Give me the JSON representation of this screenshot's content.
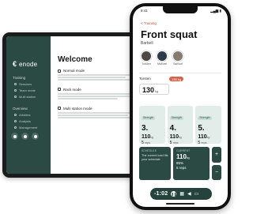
{
  "tablet": {
    "app": {
      "logo_mark": "€",
      "logo_text": "enode"
    },
    "sidebar": {
      "sections": [
        {
          "label": "Training",
          "items": [
            "Sessions",
            "Team mode",
            "Multi station"
          ]
        },
        {
          "label": "Overview",
          "items": [
            "Athletes",
            "Analysis",
            "Management"
          ]
        }
      ]
    },
    "main": {
      "title": "Welcome",
      "modes": [
        {
          "label": "Normal mode",
          "icon": "user-icon"
        },
        {
          "label": "Rack mode",
          "icon": "rack-icon"
        },
        {
          "label": "Multi station mode",
          "icon": "station-icon"
        }
      ]
    }
  },
  "phone": {
    "status": {
      "time": "9:41",
      "icons": "▂▄▆ ▮"
    },
    "back_label": "< Training",
    "exercise": {
      "title": "Front squat",
      "subtitle": "Barbell"
    },
    "athletes": [
      {
        "name": "Torsten"
      },
      {
        "name": "Michael"
      },
      {
        "name": "Samuel"
      }
    ],
    "current": {
      "name": "Torsten",
      "badge": "135 kg",
      "weight": "130",
      "unit": "kg"
    },
    "sets": [
      {
        "label": "Strength",
        "num": "3.",
        "kg": "110",
        "kg_unit": "kg",
        "reps": "5",
        "reps_unit": "reps"
      },
      {
        "label": "Strength",
        "num": "4.",
        "kg": "110",
        "kg_unit": "kg",
        "reps": "5",
        "reps_unit": "reps"
      },
      {
        "label": "Strength",
        "num": "5.",
        "kg": "110",
        "kg_unit": "kg",
        "reps": "5",
        "reps_unit": "reps"
      }
    ],
    "schedule": {
      "label": "SCHEDULE",
      "text": "The current load fits your schedule"
    },
    "current_set": {
      "label": "CURRENT",
      "kg": "110",
      "kg_unit": "kg",
      "reps": "5",
      "reps_unit": "reps",
      "pct": "85%"
    },
    "stepper": {
      "plus": "+",
      "minus": "−"
    },
    "player": {
      "time": "-1:02",
      "pause": "❚❚",
      "glyph1": "▦",
      "glyph2": "◀",
      "glyph3": "▭"
    }
  },
  "colors": {
    "brand_dark": "#2b4a43",
    "accent": "#d9624c",
    "tint": "#e2ece8"
  }
}
